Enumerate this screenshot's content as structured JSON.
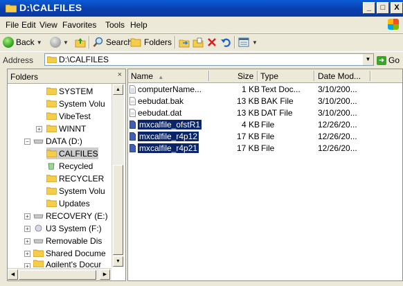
{
  "window": {
    "title": "D:\\CALFILES",
    "min": "_",
    "max": "□",
    "close": "X"
  },
  "menu": [
    "File",
    "Edit",
    "View",
    "Favorites",
    "Tools",
    "Help"
  ],
  "toolbar": {
    "back": "Back",
    "search": "Search",
    "folders": "Folders"
  },
  "address": {
    "label": "Address",
    "value": "D:\\CALFILES",
    "go": "Go"
  },
  "folders_pane": {
    "title": "Folders",
    "close": "×",
    "items": [
      {
        "label": "SYSTEM"
      },
      {
        "label": "System Volu"
      },
      {
        "label": "VibeTest"
      },
      {
        "label": "WINNT"
      },
      {
        "label": "DATA (D:)"
      },
      {
        "label": "CALFILES"
      },
      {
        "label": "Recycled"
      },
      {
        "label": "RECYCLER"
      },
      {
        "label": "System Volu"
      },
      {
        "label": "Updates"
      },
      {
        "label": "RECOVERY (E:)"
      },
      {
        "label": "U3 System (F:)"
      },
      {
        "label": "Removable Dis"
      },
      {
        "label": "Shared Docume"
      },
      {
        "label": "Agilent's Docur"
      }
    ]
  },
  "list": {
    "columns": {
      "name": "Name",
      "sort_marker": "▲",
      "size": "Size",
      "type": "Type",
      "date": "Date Mod..."
    },
    "files": [
      {
        "name": "computerName...",
        "size": "1 KB",
        "type": "Text Doc...",
        "date": "3/10/200..."
      },
      {
        "name": "eebudat.bak",
        "size": "13 KB",
        "type": "BAK File",
        "date": "3/10/200..."
      },
      {
        "name": "eebudat.dat",
        "size": "13 KB",
        "type": "DAT File",
        "date": "3/10/200..."
      },
      {
        "name": "mxcalfile_ofstR1",
        "size": "4 KB",
        "type": "File",
        "date": "12/26/20..."
      },
      {
        "name": "mxcalfile_r4p12",
        "size": "17 KB",
        "type": "File",
        "date": "12/26/20..."
      },
      {
        "name": "mxcalfile_r4p21",
        "size": "17 KB",
        "type": "File",
        "date": "12/26/20..."
      }
    ]
  },
  "colors": {
    "title_bar": "#0a3fae",
    "selection": "#0a246a",
    "folder": "#f5cd4b"
  }
}
